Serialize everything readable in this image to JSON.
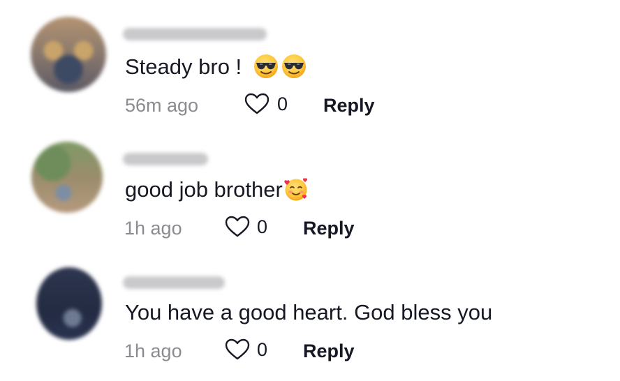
{
  "comments": [
    {
      "text": "Steady bro !",
      "emojis": [
        "smiling-face-with-sunglasses",
        "smiling-face-with-sunglasses"
      ],
      "time": "56m ago",
      "likes": "0",
      "reply_label": "Reply"
    },
    {
      "text": "good job brother",
      "emojis": [
        "smiling-face-with-hearts"
      ],
      "time": "1h ago",
      "likes": "0",
      "reply_label": "Reply"
    },
    {
      "text": "You have a good heart. God bless you",
      "emojis": [],
      "time": "1h ago",
      "likes": "0",
      "reply_label": "Reply"
    }
  ],
  "colors": {
    "text_primary": "#161823",
    "text_secondary": "#8a8b91"
  }
}
